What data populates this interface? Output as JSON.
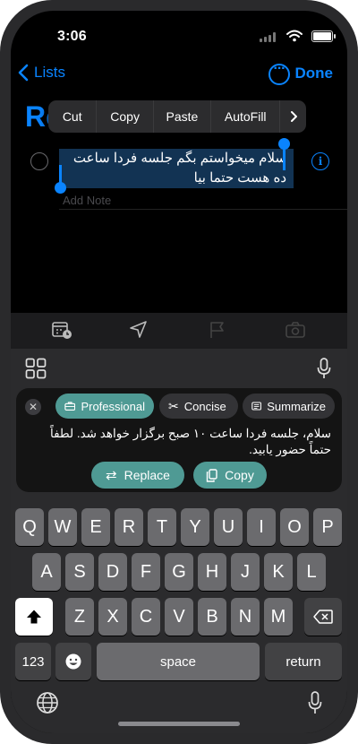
{
  "status": {
    "time": "3:06"
  },
  "nav": {
    "back_label": "Lists",
    "done_label": "Done"
  },
  "list_title_fragment": "Re",
  "edit_menu": [
    "Cut",
    "Copy",
    "Paste",
    "AutoFill"
  ],
  "reminder": {
    "text": "سلام میخواستم بگم جلسه فردا ساعت ده هست حتما بیا",
    "note_placeholder": "Add Note"
  },
  "writing_tools": {
    "chips": [
      {
        "label": "Professional",
        "active": true
      },
      {
        "label": "Concise",
        "active": false
      },
      {
        "label": "Summarize",
        "active": false
      }
    ],
    "result": "سلام، جلسه فردا ساعت ۱۰ صبح برگزار خواهد شد. لطفاً حتماً حضور یابید.",
    "replace_label": "Replace",
    "copy_label": "Copy"
  },
  "keyboard": {
    "row1": [
      "Q",
      "W",
      "E",
      "R",
      "T",
      "Y",
      "U",
      "I",
      "O",
      "P"
    ],
    "row2": [
      "A",
      "S",
      "D",
      "F",
      "G",
      "H",
      "J",
      "K",
      "L"
    ],
    "row3": [
      "Z",
      "X",
      "C",
      "V",
      "B",
      "N",
      "M"
    ],
    "numbers_label": "123",
    "space_label": "space",
    "return_label": "return"
  },
  "colors": {
    "accent": "#0a84ff",
    "ai_accent": "#4f9a94",
    "selection": "#123353"
  }
}
